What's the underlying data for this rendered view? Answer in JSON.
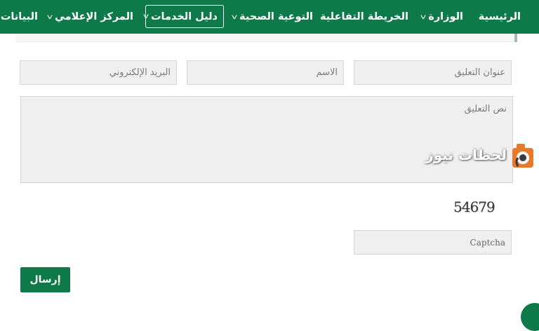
{
  "nav": {
    "items": [
      {
        "label": "الرئيسية",
        "has_dropdown": false
      },
      {
        "label": "الوزارة",
        "has_dropdown": true
      },
      {
        "label": "الخريطة التفاعلية",
        "has_dropdown": false
      },
      {
        "label": "التوعية الصحية",
        "has_dropdown": true
      },
      {
        "label": "دليل الخدمات",
        "has_dropdown": true,
        "active": true
      },
      {
        "label": "المركز الإعلامي",
        "has_dropdown": true
      },
      {
        "label": "البيانات",
        "has_dropdown": false
      }
    ],
    "dropdown_glyph": "v"
  },
  "form": {
    "comment_title": {
      "placeholder": "عنوان التعليق",
      "value": ""
    },
    "name": {
      "placeholder": "الاسم",
      "value": ""
    },
    "email": {
      "placeholder": "البريد الإلكتروني",
      "value": ""
    },
    "comment_body": {
      "placeholder": "نص التعليق",
      "value": ""
    },
    "captcha_image_text": "54679",
    "captcha": {
      "placeholder": "Captcha",
      "value": ""
    },
    "submit_label": "إرسال"
  },
  "watermark": {
    "text": "لحظات نيوز"
  },
  "colors": {
    "brand_green": "#0e7a4a",
    "field_bg": "#efefef",
    "watermark_orange": "#e8782a"
  }
}
